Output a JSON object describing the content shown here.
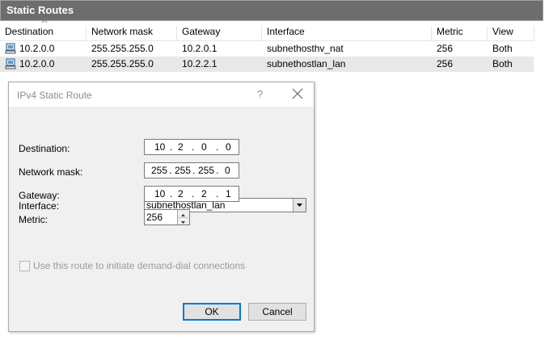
{
  "panel": {
    "title": "Static Routes"
  },
  "columns": [
    "Destination",
    "Network mask",
    "Gateway",
    "Interface",
    "Metric",
    "View"
  ],
  "routes": [
    {
      "destination": "10.2.0.0",
      "mask": "255.255.255.0",
      "gateway": "10.2.0.1",
      "interface": "subnethosthv_nat",
      "metric": "256",
      "view": "Both"
    },
    {
      "destination": "10.2.0.0",
      "mask": "255.255.255.0",
      "gateway": "10.2.2.1",
      "interface": "subnethostlan_lan",
      "metric": "256",
      "view": "Both"
    }
  ],
  "dialog": {
    "title": "IPv4 Static Route",
    "help": "?",
    "interface_label": "Interface:",
    "interface_value": "subnethostlan_lan",
    "destination_label": "Destination:",
    "destination": [
      "10",
      "2",
      "0",
      "0"
    ],
    "mask_label": "Network mask:",
    "mask": [
      "255",
      "255",
      "255",
      "0"
    ],
    "gateway_label": "Gateway:",
    "gateway": [
      "10",
      "2",
      "2",
      "1"
    ],
    "metric_label": "Metric:",
    "metric": "256",
    "demand_dial_label": "Use this route to initiate demand-dial connections",
    "ok_label": "OK",
    "cancel_label": "Cancel",
    "dot": "."
  }
}
